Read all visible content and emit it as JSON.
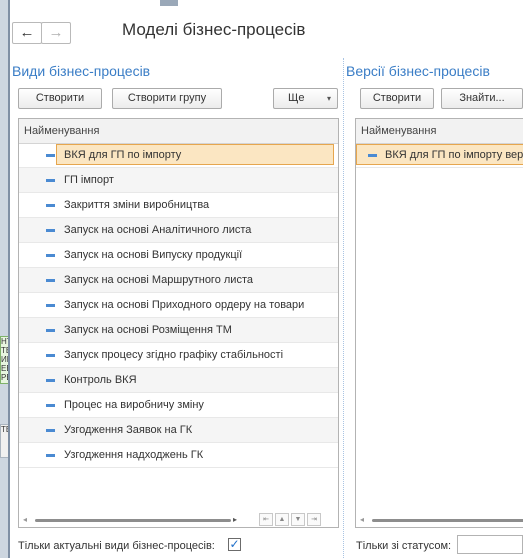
{
  "window": {
    "title": "Моделі бізнес-процесів",
    "back_icon": "←",
    "forward_icon": "→"
  },
  "left": {
    "section_title": "Види бізнес-процесів",
    "buttons": {
      "create": "Створити",
      "create_group": "Створити групу",
      "more": "Ще",
      "more_arrow": "▾"
    },
    "column_header": "Найменування",
    "items": [
      "ВКЯ для ГП по імпорту",
      "ГП імпорт",
      "Закриття зміни виробництва",
      "Запуск на основі Аналітичного листа",
      "Запуск на основі Випуску продукції",
      "Запуск на основі Маршрутного листа",
      "Запуск на основі Приходного ордеру на товари",
      "Запуск на основі Розміщення ТМ",
      "Запуск процесу згідно графіку стабільності",
      "Контроль ВКЯ",
      "Процес на виробничу зміну",
      "Узгодження Заявок на ГК",
      "Узгодження надходжень ГК"
    ],
    "footer_label": "Тільки актуальні види бізнес-процесів:",
    "footer_checked": "✓",
    "scroll_glyphs": {
      "left": "◂",
      "right": "▸",
      "first": "⇤",
      "up": "▲",
      "down": "▼",
      "last": "⇥"
    }
  },
  "right": {
    "section_title": "Версії бізнес-процесів",
    "buttons": {
      "create": "Створити",
      "find": "Знайти..."
    },
    "column_header": "Найменування",
    "items": [
      "ВКЯ для ГП по імпорту вер"
    ],
    "footer_label": "Тільки зі статусом:",
    "status_value": ""
  },
  "background": {
    "note1": [
      "НТ",
      "ТВ",
      "ИЕ",
      "ЕЕ",
      "РЕ"
    ],
    "note2": [
      "ТВ",
      "ИЕ",
      "З"
    ]
  },
  "colors": {
    "accent": "#3a7dc6",
    "selection_fill": "#fbe6c2",
    "selection_border": "#e6a64e",
    "item_marker": "#4a8ad2"
  }
}
